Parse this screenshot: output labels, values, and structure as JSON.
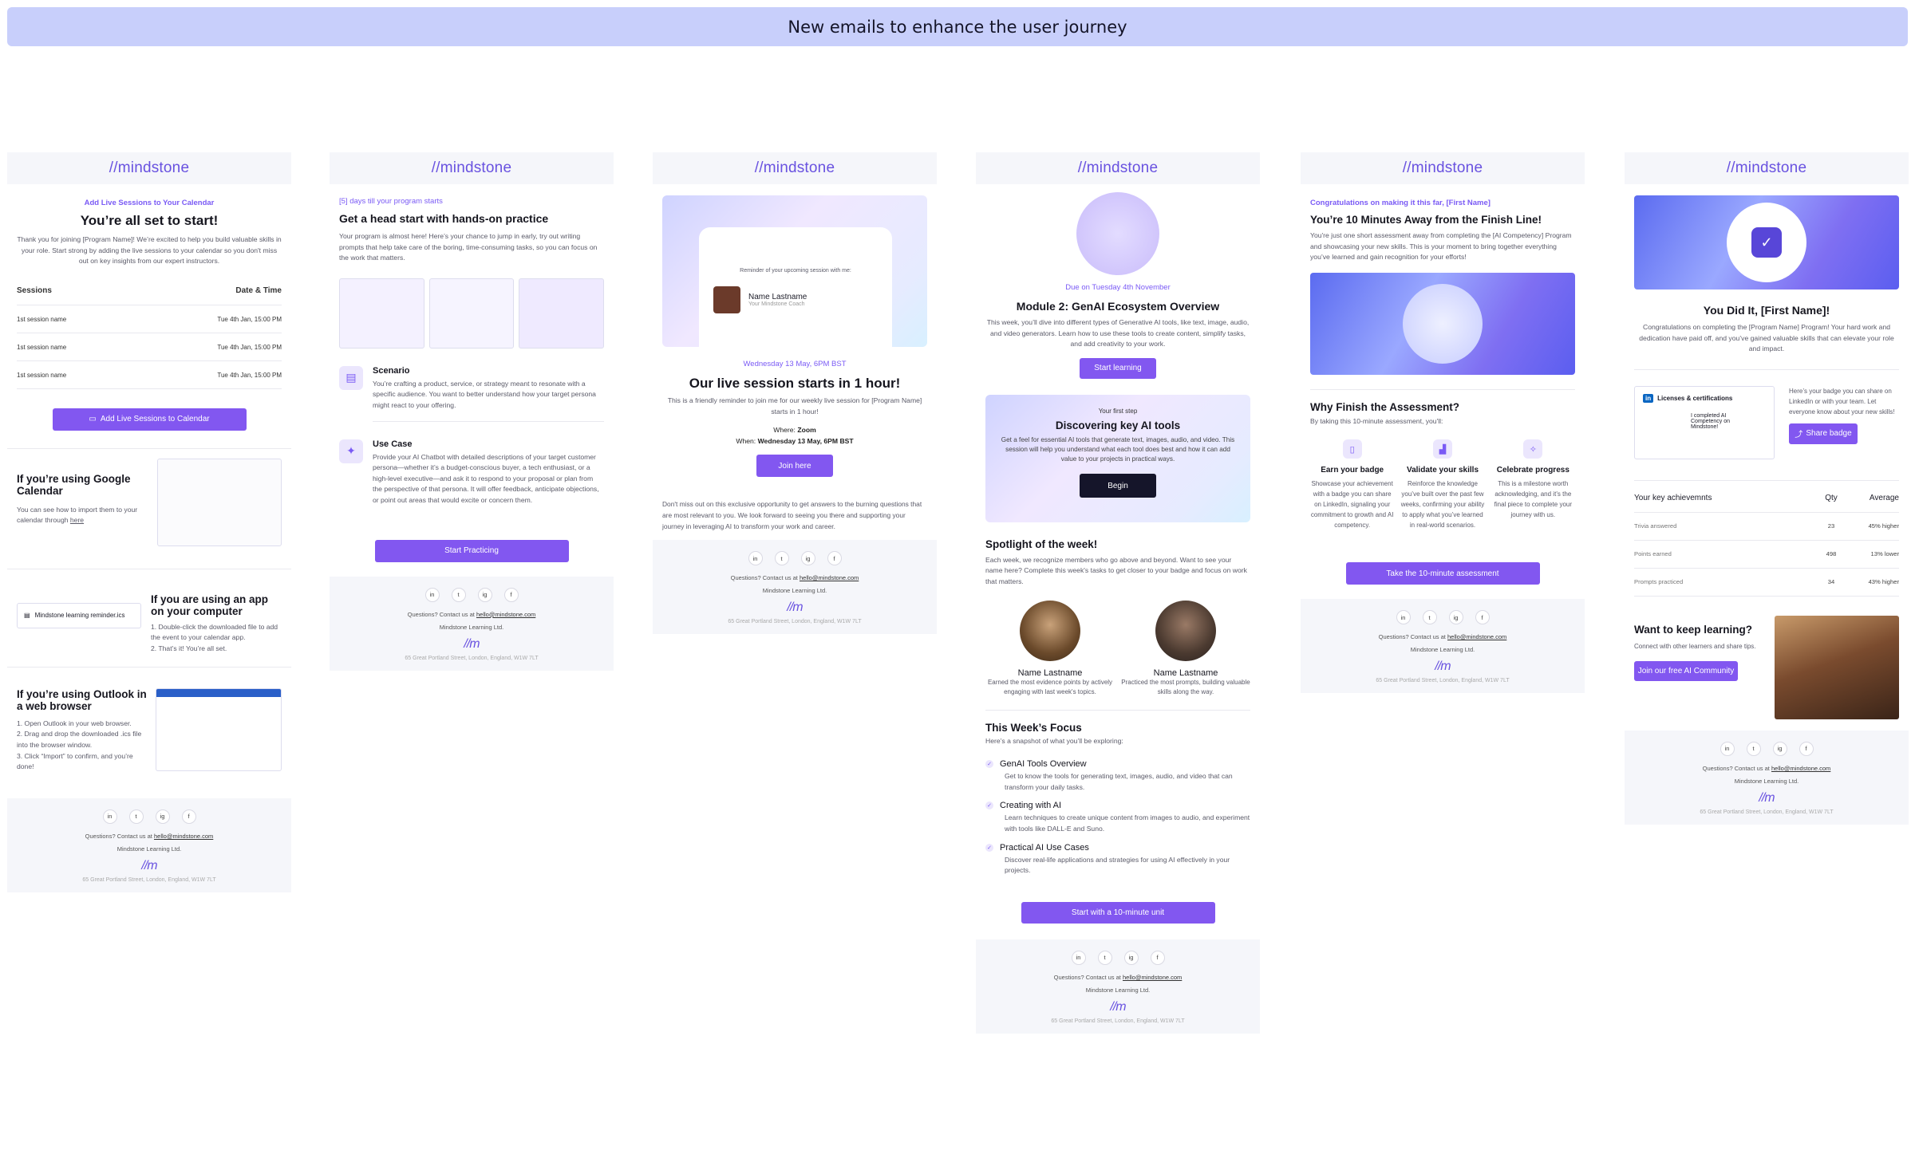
{
  "banner_title": "New emails to enhance the user journey",
  "brand": "mindstone",
  "brand_mark": "//m",
  "footer": {
    "questions": "Questions? Contact us at",
    "email": "hello@mindstone.com",
    "company": "Mindstone Learning Ltd.",
    "address": "65 Great Portland Street, London, England, W1W 7LT",
    "social": [
      "in",
      "t",
      "ig",
      "f"
    ]
  },
  "e1": {
    "eyebrow": "Add Live Sessions to Your Calendar",
    "title": "You’re all set to start!",
    "body": "Thank you for joining [Program Name]! We’re excited to help you build valuable skills in your role. Start strong by adding the live sessions to your calendar so you don't miss out on key insights from our expert instructors.",
    "col1": "Sessions",
    "col2": "Date & Time",
    "rows": [
      [
        "1st session name",
        "Tue 4th Jan, 15:00 PM"
      ],
      [
        "1st session name",
        "Tue 4th Jan, 15:00 PM"
      ],
      [
        "1st session name",
        "Tue 4th Jan, 15:00 PM"
      ]
    ],
    "cta": "Add Live Sessions to Calendar",
    "g_title": "If you’re using Google Calendar",
    "g_body": "You can see how to import them to your calendar through",
    "g_link": "here",
    "app_title": "If you are using an app on your computer",
    "app_file": "Mindstone learning reminder.ics",
    "app_steps": [
      "1. Double-click the downloaded file to add the event to your calendar app.",
      "2. That’s it! You’re all set."
    ],
    "o_title": "If you’re using Outlook in a web browser",
    "o_steps": [
      "1. Open Outlook in your web browser.",
      "2. Drag and drop the downloaded .ics file into the browser window.",
      "3. Click “Import” to confirm, and you’re done!"
    ]
  },
  "e2": {
    "eyebrow": "[5] days till your program starts",
    "title": "Get a head start with hands-on practice",
    "body": "Your program is almost here! Here’s your chance to jump in early, try out writing prompts that help take care of the boring, time-consuming tasks, so you can focus on the work that matters.",
    "s_title": "Scenario",
    "s_body": "You’re crafting a product, service, or strategy meant to resonate with a specific audience. You want to better understand how your target persona might react to your offering.",
    "u_title": "Use Case",
    "u_body": "Provide your AI Chatbot with detailed descriptions of your target customer persona—whether it’s a budget-conscious buyer, a tech enthusiast, or a high-level executive—and ask it to respond to your proposal or plan from the perspective of that persona. It will offer feedback, anticipate objections, or point out areas that would excite or concern them.",
    "cta": "Start Practicing"
  },
  "e3": {
    "reminder": "Reminder of your upcoming session with me:",
    "coach_name": "Name Lastname",
    "coach_role": "Your Mindstone Coach",
    "date": "Wednesday 13 May, 6PM BST",
    "title": "Our live session starts in 1 hour!",
    "body": "This is a friendly reminder to join me for our weekly live session for [Program Name] starts in 1 hour!",
    "where_label": "Where:",
    "where": "Zoom",
    "when_label": "When:",
    "when": "Wednesday 13 May, 6PM BST",
    "cta": "Join here",
    "body2": "Don't miss out on this exclusive opportunity to get answers to the burning questions that are most relevant to you. We look forward to seeing you there and supporting your journey in leveraging AI to transform your work and career."
  },
  "e4": {
    "due": "Due on Tuesday 4th November",
    "title": "Module 2: GenAI Ecosystem Overview",
    "body": "This week, you’ll dive into different types of Generative AI tools, like text, image, audio, and video generators. Learn how to use these tools to create content, simplify tasks, and add creativity to your work.",
    "cta": "Start learning",
    "step_label": "Your first step",
    "step_title": "Discovering key AI tools",
    "step_body": "Get a feel for essential AI tools that generate text, images, audio, and video. This session will help you understand what each tool does best and how it can add value to your projects in practical ways.",
    "step_cta": "Begin",
    "spot_title": "Spotlight of the week!",
    "spot_body": "Each week, we recognize members who go above and beyond. Want to see your name here? Complete this week's tasks to get closer to your badge and focus on work that matters.",
    "people": [
      {
        "name": "Name Lastname",
        "desc": "Earned the most evidence points by actively engaging with last week's topics."
      },
      {
        "name": "Name Lastname",
        "desc": "Practiced the most prompts, building valuable skills along the way."
      }
    ],
    "focus_title": "This Week’s Focus",
    "focus_sub": "Here’s a snapshot of what you’ll be exploring:",
    "focus": [
      {
        "t": "GenAI Tools Overview",
        "d": "Get to know the tools for generating text, images, audio, and video that can transform your daily tasks."
      },
      {
        "t": "Creating with AI",
        "d": "Learn techniques to create unique content from images to audio, and experiment with tools like DALL-E and Suno."
      },
      {
        "t": "Practical AI Use Cases",
        "d": "Discover real-life applications and strategies for using AI effectively in your projects."
      }
    ],
    "cta2": "Start with a 10-minute unit"
  },
  "e5": {
    "eyebrow": "Congratulations on making it this far, [First Name]",
    "title": "You’re 10 Minutes Away from the Finish Line!",
    "body": "You're just one short assessment away from completing the [AI Competency] Program and showcasing your new skills. This is your moment to bring together everything you’ve learned and gain recognition for your efforts!",
    "why_title": "Why Finish the Assessment?",
    "why_sub": "By taking this 10-minute assessment, you'll:",
    "cols": [
      {
        "t": "Earn your badge",
        "d": "Showcase your achievement with a badge you can share on LinkedIn, signaling your commitment to growth and AI competency."
      },
      {
        "t": "Validate your skills",
        "d": "Reinforce the knowledge you’ve built over the past few weeks, confirming your ability to apply what you’ve learned in real-world scenarios."
      },
      {
        "t": "Celebrate progress",
        "d": "This is a milestone worth acknowledging, and it’s the final piece to complete your journey with us."
      }
    ],
    "cta": "Take the 10-minute assessment"
  },
  "e6": {
    "title": "You Did It, [First Name]!",
    "body": "Congratulations on completing the [Program Name] Program! Your hard work and dedication have paid off, and you’ve gained valuable skills that can elevate your role and impact.",
    "lic": "Licenses & certifications",
    "lic_item": "I completed AI Competency on Mindstone!",
    "share_text": "Here’s your badge you can share on LinkedIn or with your team. Let everyone know about your new skills!",
    "share_cta": "Share badge",
    "ach_title": "Your key achievemnts",
    "qty": "Qty",
    "avg": "Average",
    "ach": [
      [
        "Trivia answered",
        "23",
        "45% higher"
      ],
      [
        "Points earned",
        "498",
        "13% lower"
      ],
      [
        "Prompts practiced",
        "34",
        "43% higher"
      ]
    ],
    "keep_title": "Want to keep learning?",
    "keep_body": "Connect with other learners and share tips.",
    "keep_cta": "Join our free AI Community"
  }
}
